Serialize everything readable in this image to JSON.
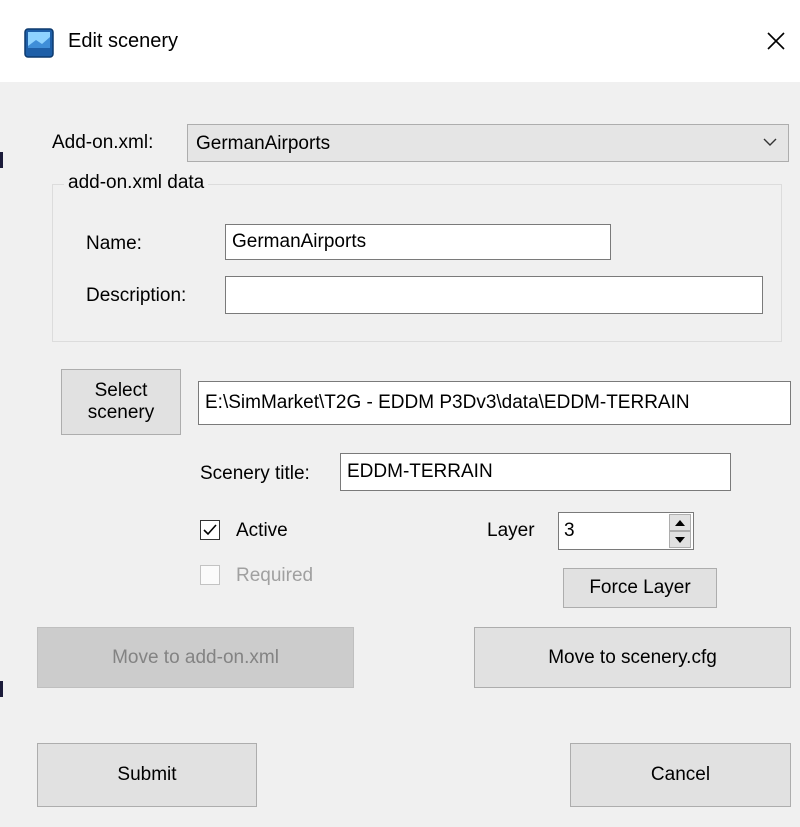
{
  "window": {
    "title": "Edit scenery",
    "icon": "app-icon",
    "close_icon": "close-icon"
  },
  "addon": {
    "label": "Add-on.xml:",
    "selected": "GermanAirports"
  },
  "group": {
    "caption": "add-on.xml data",
    "name_label": "Name:",
    "name_value": "GermanAirports",
    "description_label": "Description:",
    "description_value": ""
  },
  "scenery": {
    "select_button": "Select\nscenery",
    "path": "E:\\SimMarket\\T2G - EDDM P3Dv3\\data\\EDDM-TERRAIN",
    "title_label": "Scenery title:",
    "title_value": "EDDM-TERRAIN"
  },
  "options": {
    "active_label": "Active",
    "active_checked": true,
    "required_label": "Required",
    "required_checked": false,
    "layer_label": "Layer",
    "layer_value": "3",
    "force_layer_button": "Force Layer"
  },
  "actions": {
    "move_to_addon": "Move to add-on.xml",
    "move_to_scenery": "Move to scenery.cfg",
    "submit": "Submit",
    "cancel": "Cancel"
  },
  "colors": {
    "dialog_bg": "#f0f0f0",
    "button_bg": "#e1e1e1",
    "disabled_button_bg": "#cccccc",
    "disabled_text": "#838383"
  }
}
